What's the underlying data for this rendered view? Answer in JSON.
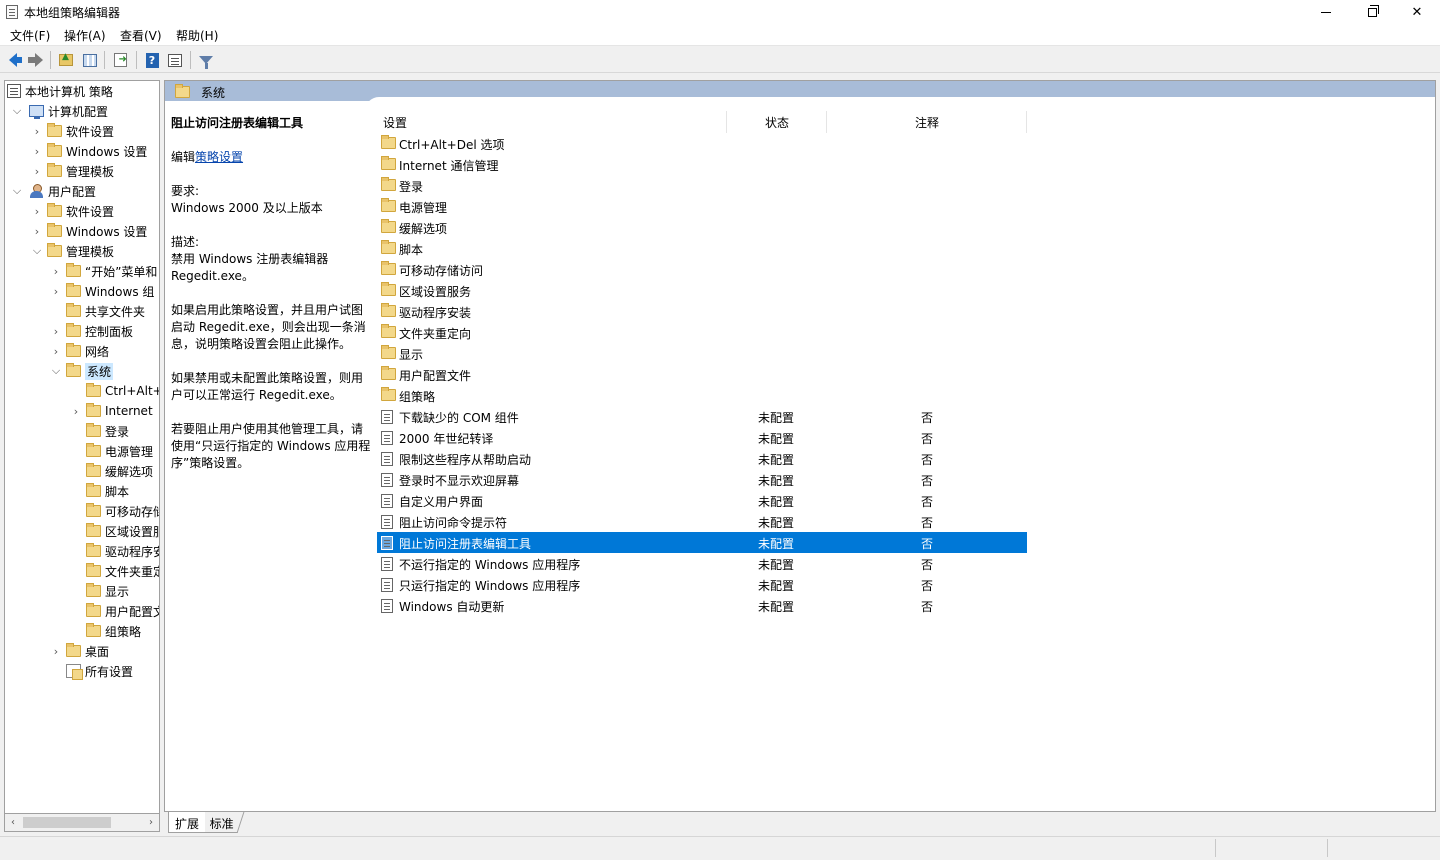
{
  "window": {
    "title": "本地组策略编辑器",
    "minimize": "",
    "maximize": "",
    "close": "✕"
  },
  "menu": [
    "文件(F)",
    "操作(A)",
    "查看(V)",
    "帮助(H)"
  ],
  "tree": {
    "root": "本地计算机 策略",
    "computer_config": "计算机配置",
    "computer_children": [
      "软件设置",
      "Windows 设置",
      "管理模板"
    ],
    "user_config": "用户配置",
    "user_children": [
      "软件设置",
      "Windows 设置",
      "管理模板"
    ],
    "admin_templates": [
      "“开始”菜单和",
      "Windows 组",
      "共享文件夹",
      "控制面板",
      "网络",
      "系统"
    ],
    "system_children": [
      "Ctrl+Alt+",
      "Internet",
      "登录",
      "电源管理",
      "缓解选项",
      "脚本",
      "可移动存储",
      "区域设置服",
      "驱动程序安",
      "文件夹重定",
      "显示",
      "用户配置文",
      "组策略"
    ],
    "desktop": "桌面",
    "all_settings": "所有设置"
  },
  "pane": {
    "header_title": "系统",
    "columns": {
      "setting": "设置",
      "state": "状态",
      "comment": "注释"
    }
  },
  "description": {
    "title": "阻止访问注册表编辑工具",
    "edit_prefix": "编辑",
    "edit_link": "策略设置",
    "requirements_label": "要求:",
    "requirements": "Windows 2000 及以上版本",
    "desc_label": "描述:",
    "desc1": "禁用 Windows 注册表编辑器 Regedit.exe。",
    "desc2": "如果启用此策略设置，并且用户试图启动 Regedit.exe，则会出现一条消息，说明策略设置会阻止此操作。",
    "desc3": "如果禁用或未配置此策略设置，则用户可以正常运行 Regedit.exe。",
    "desc4": "若要阻止用户使用其他管理工具，请使用“只运行指定的 Windows 应用程序”策略设置。"
  },
  "folders": [
    "Ctrl+Alt+Del 选项",
    "Internet 通信管理",
    "登录",
    "电源管理",
    "缓解选项",
    "脚本",
    "可移动存储访问",
    "区域设置服务",
    "驱动程序安装",
    "文件夹重定向",
    "显示",
    "用户配置文件",
    "组策略"
  ],
  "settings": [
    {
      "name": "下载缺少的 COM 组件",
      "state": "未配置",
      "comment": "否"
    },
    {
      "name": "2000 年世纪转译",
      "state": "未配置",
      "comment": "否"
    },
    {
      "name": "限制这些程序从帮助启动",
      "state": "未配置",
      "comment": "否"
    },
    {
      "name": "登录时不显示欢迎屏幕",
      "state": "未配置",
      "comment": "否"
    },
    {
      "name": "自定义用户界面",
      "state": "未配置",
      "comment": "否"
    },
    {
      "name": "阻止访问命令提示符",
      "state": "未配置",
      "comment": "否"
    },
    {
      "name": "阻止访问注册表编辑工具",
      "state": "未配置",
      "comment": "否"
    },
    {
      "name": "不运行指定的 Windows 应用程序",
      "state": "未配置",
      "comment": "否"
    },
    {
      "name": "只运行指定的 Windows 应用程序",
      "state": "未配置",
      "comment": "否"
    },
    {
      "name": "Windows 自动更新",
      "state": "未配置",
      "comment": "否"
    }
  ],
  "tabs": [
    "扩展",
    "标准"
  ],
  "colors": {
    "selection": "#0078d7",
    "header": "#a8bcd8",
    "tree_selection": "#cce8ff"
  }
}
